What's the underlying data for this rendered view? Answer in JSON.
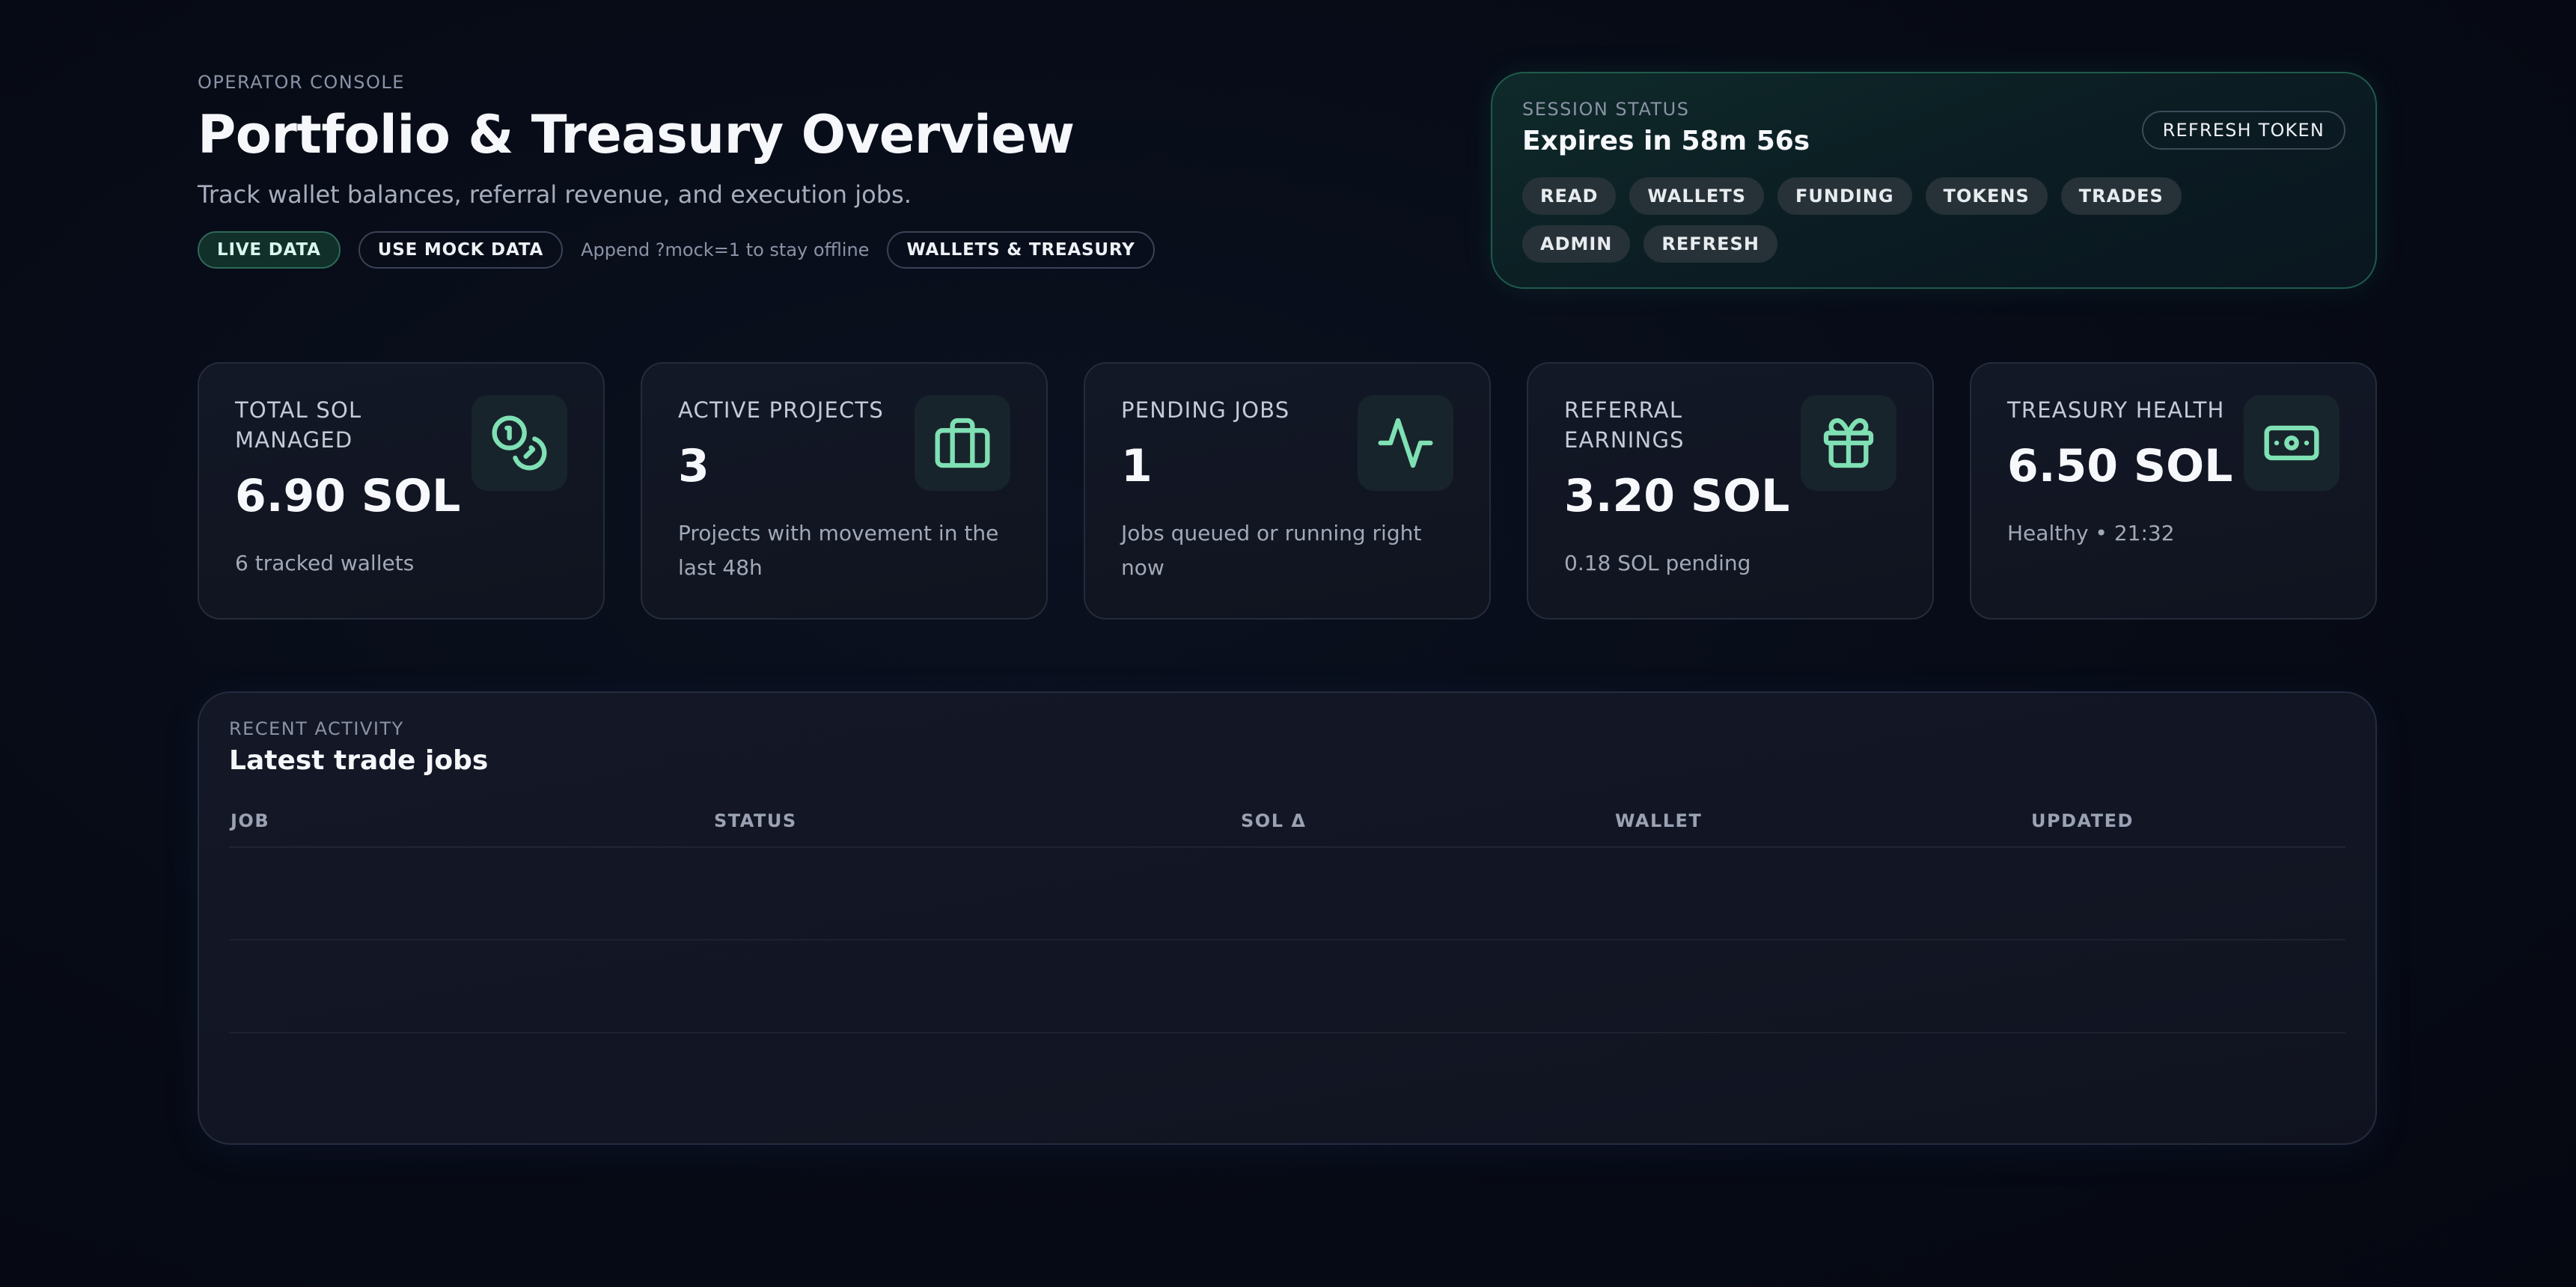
{
  "header": {
    "eyebrow": "OPERATOR CONSOLE",
    "title": "Portfolio & Treasury Overview",
    "subtitle": "Track wallet balances, referral revenue, and execution jobs.",
    "live_data_label": "LIVE DATA",
    "mock_data_label": "USE MOCK DATA",
    "mock_hint": "Append ?mock=1 to stay offline",
    "wallets_label": "WALLETS & TREASURY"
  },
  "session": {
    "eyebrow": "SESSION STATUS",
    "status": "Expires in 58m 56s",
    "refresh_label": "REFRESH TOKEN",
    "scopes": [
      "READ",
      "WALLETS",
      "FUNDING",
      "TOKENS",
      "TRADES",
      "ADMIN",
      "REFRESH"
    ]
  },
  "stats": [
    {
      "label": "TOTAL SOL MANAGED",
      "value": "6.90 SOL",
      "note": "6 tracked wallets",
      "icon": "coins-icon"
    },
    {
      "label": "ACTIVE PROJECTS",
      "value": "3",
      "note": "Projects with movement in the last 48h",
      "icon": "briefcase-icon"
    },
    {
      "label": "PENDING JOBS",
      "value": "1",
      "note": "Jobs queued or running right now",
      "icon": "activity-icon"
    },
    {
      "label": "REFERRAL EARNINGS",
      "value": "3.20 SOL",
      "note": "0.18 SOL pending",
      "icon": "gift-icon"
    },
    {
      "label": "TREASURY HEALTH",
      "value": "6.50 SOL",
      "note": "Healthy • 21:32",
      "icon": "banknote-icon"
    }
  ],
  "activity": {
    "eyebrow": "RECENT ACTIVITY",
    "title": "Latest trade jobs",
    "columns": [
      "JOB",
      "STATUS",
      "SOL Δ",
      "WALLET",
      "UPDATED"
    ],
    "rows": []
  },
  "colors": {
    "accent": "#7fe0b4",
    "background": "#070b16"
  }
}
